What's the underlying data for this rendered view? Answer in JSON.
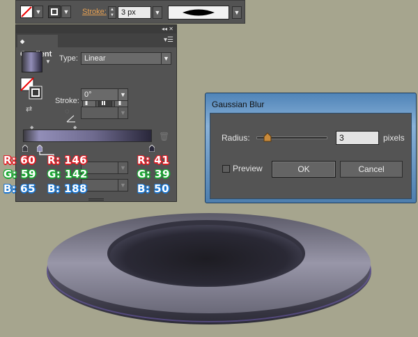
{
  "control_bar": {
    "stroke_label": "Stroke:",
    "stroke_weight": "3 px"
  },
  "gradient_panel": {
    "title": "Gradient",
    "type_label": "Type:",
    "type_value": "Linear",
    "stroke_label": "Stroke:",
    "angle_value": "0°",
    "colors": {
      "stop1": "#3c3b41",
      "stop2": "#928eb8",
      "stop3": "#29273a"
    }
  },
  "annotations": [
    {
      "r": "R: 60",
      "g": "G: 59",
      "b": "B: 65"
    },
    {
      "r": "R: 146",
      "g": "G: 142",
      "b": "B: 188"
    },
    {
      "r": "R: 41",
      "g": "G: 39",
      "b": "B: 50"
    }
  ],
  "gaussian_blur": {
    "title": "Gaussian Blur",
    "radius_label": "Radius:",
    "radius_value": "3",
    "units": "pixels",
    "preview_label": "Preview",
    "ok_label": "OK",
    "cancel_label": "Cancel"
  }
}
